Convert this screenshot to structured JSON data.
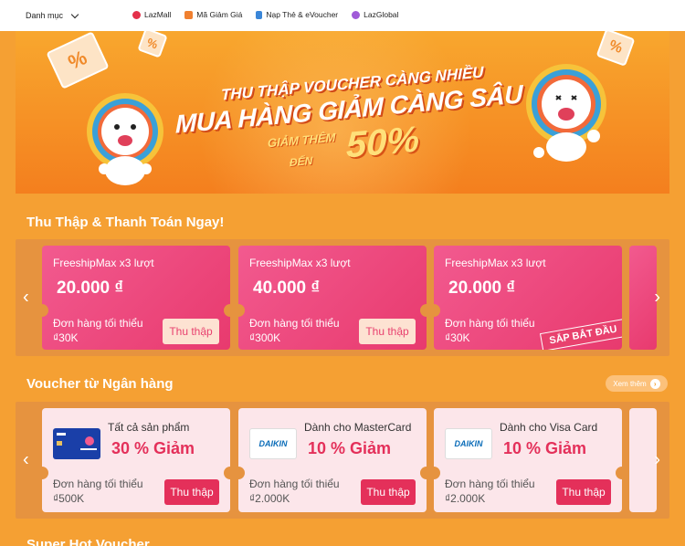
{
  "nav": {
    "category_label": "Danh mục",
    "links": [
      {
        "label": "LazMall",
        "color": "#e4304a"
      },
      {
        "label": "Mã Giảm Giá",
        "color": "#f08030"
      },
      {
        "label": "Nạp Thẻ & eVoucher",
        "color": "#3a86d8"
      },
      {
        "label": "LazGlobal",
        "color": "#a05ad8"
      }
    ]
  },
  "banner": {
    "line1": "THU THẬP VOUCHER CÀNG NHIỀU",
    "line2": "MUA HÀNG GIẢM CÀNG SÂU",
    "line3": "GIẢM THÊM",
    "line4": "ĐẾN",
    "percent": "50%"
  },
  "section1": {
    "title": "Thu Thập & Thanh Toán Ngay!",
    "vouchers": [
      {
        "name": "FreeshipMax x3 lượt",
        "amount": "20.000 ₫",
        "min_label": "Đơn hàng tối thiểu",
        "min_value": "₫30K",
        "button": "Thu thập"
      },
      {
        "name": "FreeshipMax x3 lượt",
        "amount": "40.000 ₫",
        "min_label": "Đơn hàng tối thiểu",
        "min_value": "₫300K",
        "button": "Thu thập"
      },
      {
        "name": "FreeshipMax x3 lượt",
        "amount": "20.000 ₫",
        "min_label": "Đơn hàng tối thiểu",
        "min_value": "₫30K",
        "stamp": "SẮP BẮT ĐẦU"
      }
    ]
  },
  "section2": {
    "title": "Voucher từ Ngân hàng",
    "see_more": "Xem thêm",
    "vouchers": [
      {
        "who": "Tất cả sản phẩm",
        "discount": "30 % Giảm",
        "logo": "citi-lazada-card",
        "min_label": "Đơn hàng tối thiểu",
        "min_value": "₫500K",
        "button": "Thu thập"
      },
      {
        "who": "Dành cho MasterCard",
        "discount": "10 % Giảm",
        "logo": "DAIKIN",
        "min_label": "Đơn hàng tối thiểu",
        "min_value": "₫2.000K",
        "button": "Thu thập"
      },
      {
        "who": "Dành cho Visa Card",
        "discount": "10 % Giảm",
        "logo": "DAIKIN",
        "min_label": "Đơn hàng tối thiểu",
        "min_value": "₫2.000K",
        "button": "Thu thập"
      }
    ]
  },
  "section3": {
    "title": "Super Hot Voucher"
  },
  "colors": {
    "page_bg": "#f5a033",
    "voucher_pink": "#e83a6e",
    "bank_card_bg": "#fce6ea",
    "button_red": "#e4305a"
  }
}
